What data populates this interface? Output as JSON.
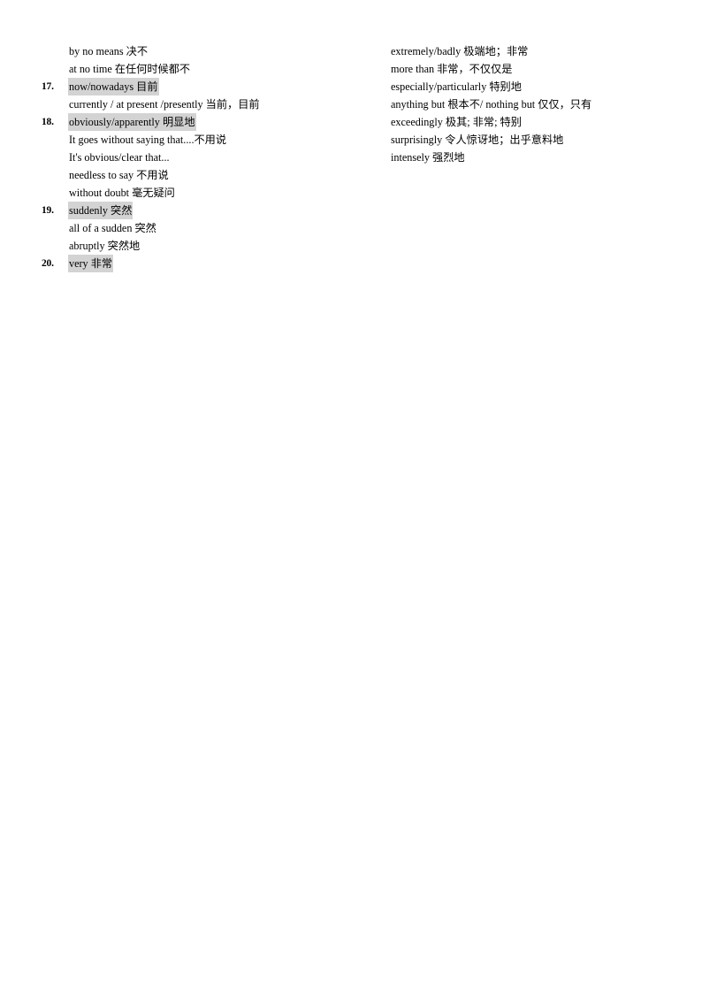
{
  "document": {
    "title": "Vocabulary list — adverbs and adverbial phrases (items 17-20)",
    "highlight_color": "#d3d3d3",
    "background_color": "#ffffff",
    "text_color": "#000000"
  },
  "left_column": {
    "lines": [
      {
        "number": "",
        "text": "by no means  决不",
        "highlighted": false
      },
      {
        "number": "",
        "text": "at no time  在任何时候都不",
        "highlighted": false
      },
      {
        "number": "17.",
        "text": "now/nowadays  目前",
        "highlighted": true
      },
      {
        "number": "",
        "text": "currently / at present /presently  当前，目前",
        "highlighted": false
      },
      {
        "number": "18.",
        "text": "obviously/apparently  明显地",
        "highlighted": true
      },
      {
        "number": "",
        "text": "It goes without saying that....不用说",
        "highlighted": false
      },
      {
        "number": "",
        "text": "It's obvious/clear  that...",
        "highlighted": false
      },
      {
        "number": "",
        "text": "needless to say 不用说",
        "highlighted": false
      },
      {
        "number": "",
        "text": "without doubt 毫无疑问",
        "highlighted": false
      },
      {
        "number": "19.",
        "text": "suddenly  突然",
        "highlighted": true
      },
      {
        "number": "",
        "text": "all of a sudden  突然",
        "highlighted": false
      },
      {
        "number": "",
        "text": "abruptly 突然地",
        "highlighted": false
      },
      {
        "number": "20.",
        "text": "very 非常",
        "highlighted": true
      }
    ]
  },
  "right_column": {
    "lines": [
      {
        "number": "",
        "text": "extremely/badly  极端地；非常",
        "highlighted": false
      },
      {
        "number": "",
        "text": "more than  非常，不仅仅是",
        "highlighted": false
      },
      {
        "number": "",
        "text": "especially/particularly   特别地",
        "highlighted": false
      },
      {
        "number": "",
        "text": "anything but  根本不/ nothing but  仅仅，只有",
        "highlighted": false
      },
      {
        "number": "",
        "text": "exceedingly   极其; 非常; 特别",
        "highlighted": false
      },
      {
        "number": "",
        "text": "surprisingly  令人惊讶地；出乎意料地",
        "highlighted": false
      },
      {
        "number": "",
        "text": "intensely 强烈地",
        "highlighted": false
      }
    ]
  }
}
